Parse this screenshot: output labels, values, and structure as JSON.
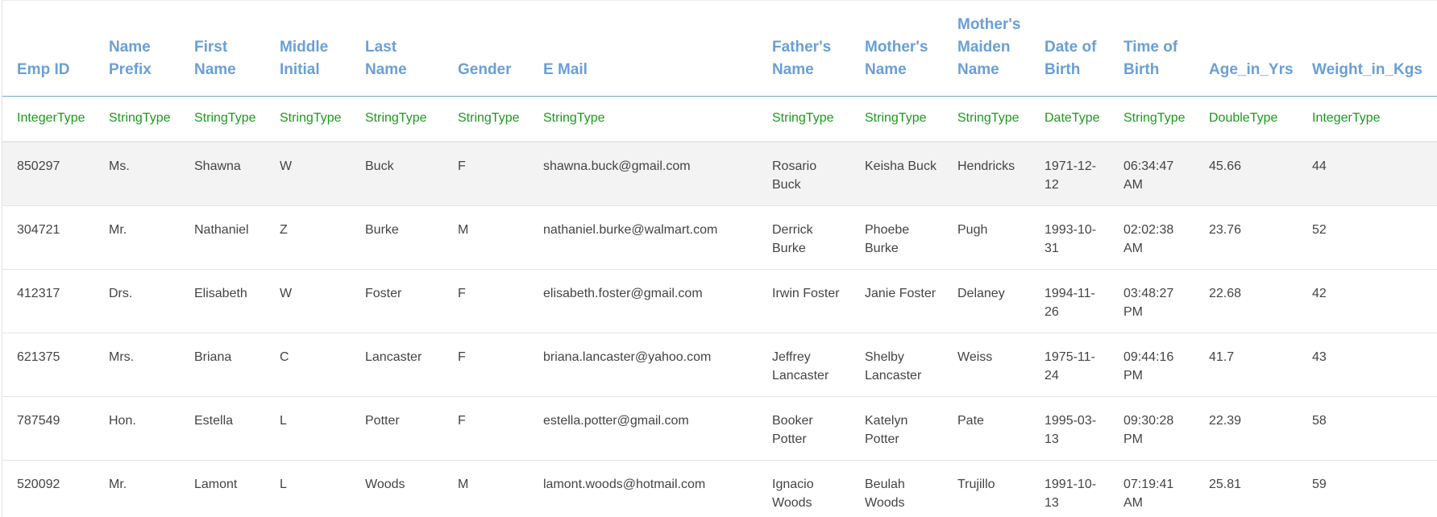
{
  "table": {
    "headers": [
      {
        "label": "Emp ID",
        "type": "IntegerType"
      },
      {
        "label": "Name Prefix",
        "type": "StringType"
      },
      {
        "label": "First Name",
        "type": "StringType"
      },
      {
        "label": "Middle Initial",
        "type": "StringType"
      },
      {
        "label": "Last Name",
        "type": "StringType"
      },
      {
        "label": "Gender",
        "type": "StringType"
      },
      {
        "label": "E Mail",
        "type": "StringType"
      },
      {
        "label": "Father's Name",
        "type": "StringType"
      },
      {
        "label": "Mother's Name",
        "type": "StringType"
      },
      {
        "label": "Mother's Maiden Name",
        "type": "StringType"
      },
      {
        "label": "Date of Birth",
        "type": "DateType"
      },
      {
        "label": "Time of Birth",
        "type": "StringType"
      },
      {
        "label": "Age_in_Yrs",
        "type": "DoubleType"
      },
      {
        "label": "Weight_in_Kgs",
        "type": "IntegerType"
      }
    ],
    "rows": [
      [
        "850297",
        "Ms.",
        "Shawna",
        "W",
        "Buck",
        "F",
        "shawna.buck@gmail.com",
        "Rosario Buck",
        "Keisha Buck",
        "Hendricks",
        "1971-12-12",
        "06:34:47 AM",
        "45.66",
        "44"
      ],
      [
        "304721",
        "Mr.",
        "Nathaniel",
        "Z",
        "Burke",
        "M",
        "nathaniel.burke@walmart.com",
        "Derrick Burke",
        "Phoebe Burke",
        "Pugh",
        "1993-10-31",
        "02:02:38 AM",
        "23.76",
        "52"
      ],
      [
        "412317",
        "Drs.",
        "Elisabeth",
        "W",
        "Foster",
        "F",
        "elisabeth.foster@gmail.com",
        "Irwin Foster",
        "Janie Foster",
        "Delaney",
        "1994-11-26",
        "03:48:27 PM",
        "22.68",
        "42"
      ],
      [
        "621375",
        "Mrs.",
        "Briana",
        "C",
        "Lancaster",
        "F",
        "briana.lancaster@yahoo.com",
        "Jeffrey Lancaster",
        "Shelby Lancaster",
        "Weiss",
        "1975-11-24",
        "09:44:16 PM",
        "41.7",
        "43"
      ],
      [
        "787549",
        "Hon.",
        "Estella",
        "L",
        "Potter",
        "F",
        "estella.potter@gmail.com",
        "Booker Potter",
        "Katelyn Potter",
        "Pate",
        "1995-03-13",
        "09:30:28 PM",
        "22.39",
        "58"
      ],
      [
        "520092",
        "Mr.",
        "Lamont",
        "L",
        "Woods",
        "M",
        "lamont.woods@hotmail.com",
        "Ignacio Woods",
        "Beulah Woods",
        "Trujillo",
        "1991-10-13",
        "07:19:41 AM",
        "25.81",
        "59"
      ]
    ]
  },
  "colors": {
    "header_text": "#6a9fd6",
    "type_text": "#1b9a1b",
    "cell_text": "#444444",
    "highlight_row": "#f3f3f3"
  }
}
